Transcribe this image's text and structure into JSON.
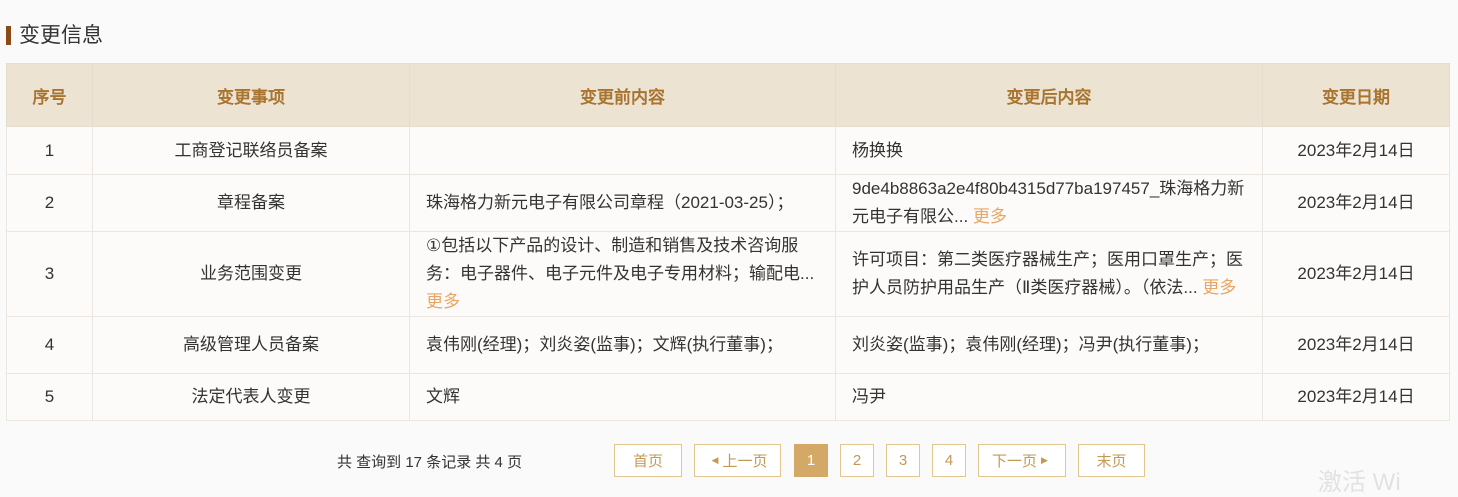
{
  "section": {
    "title": "变更信息"
  },
  "table": {
    "headers": [
      "序号",
      "变更事项",
      "变更前内容",
      "变更后内容",
      "变更日期"
    ],
    "rows": [
      {
        "no": "1",
        "item": "工商登记联络员备案",
        "before": "",
        "before_more": "",
        "after": "杨换换",
        "after_more": "",
        "date": "2023年2月14日"
      },
      {
        "no": "2",
        "item": "章程备案",
        "before": "珠海格力新元电子有限公司章程（2021-03-25）；",
        "before_more": "",
        "after": "9de4b8863a2e4f80b4315d77ba197457_珠海格力新元电子有限公...",
        "after_more": "更多",
        "date": "2023年2月14日"
      },
      {
        "no": "3",
        "item": "业务范围变更",
        "before": "①包括以下产品的设计、制造和销售及技术咨询服务：电子器件、电子元件及电子专用材料；输配电...",
        "before_more": "更多",
        "after": "许可项目：第二类医疗器械生产；医用口罩生产；医护人员防护用品生产（Ⅱ类医疗器械）。（依法...",
        "after_more": "更多",
        "date": "2023年2月14日"
      },
      {
        "no": "4",
        "item": "高级管理人员备案",
        "before": "袁伟刚(经理)；刘炎姿(监事)；文辉(执行董事)；",
        "before_more": "",
        "after": "刘炎姿(监事)；袁伟刚(经理)；冯尹(执行董事)；",
        "after_more": "",
        "date": "2023年2月14日"
      },
      {
        "no": "5",
        "item": "法定代表人变更",
        "before": "文辉",
        "before_more": "",
        "after": "冯尹",
        "after_more": "",
        "date": "2023年2月14日"
      }
    ]
  },
  "pagination": {
    "info_prefix": "共 查询到",
    "total_records": "17",
    "records_unit": "条记录 共",
    "total_pages": "4",
    "pages_unit": "页",
    "first": "首页",
    "prev": "上一页",
    "pages": [
      "1",
      "2",
      "3",
      "4"
    ],
    "current": "1",
    "next": "下一页",
    "last": "末页"
  },
  "watermark": {
    "text": "激活 Wi"
  },
  "colors": {
    "accent_brown": "#8a4b16",
    "header_bg": "#ece3d3",
    "header_text": "#a8742f",
    "more_link": "#e8a563",
    "pager_active": "#d4a867",
    "pager_border": "#e2c58f"
  }
}
